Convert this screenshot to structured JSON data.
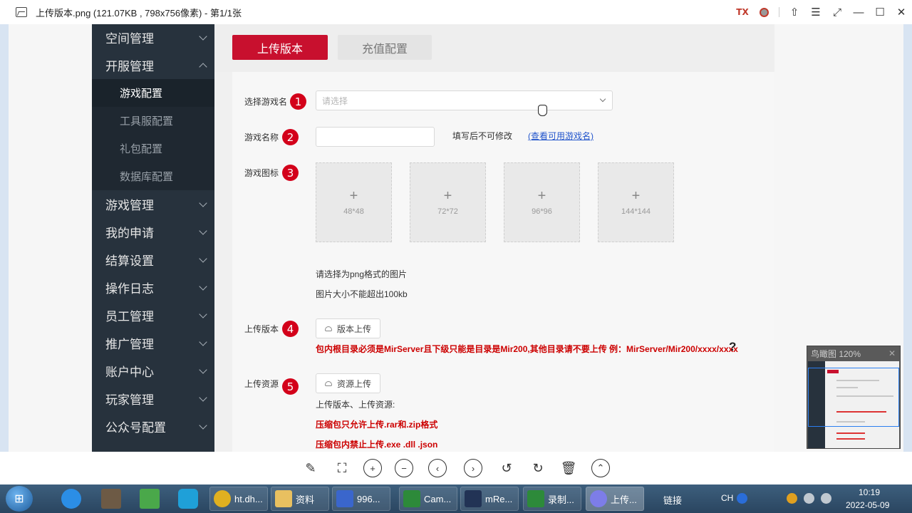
{
  "window": {
    "title": "上传版本.png (121.07KB , 798x756像素) - 第1/1张",
    "tx_label": "TX"
  },
  "sidebar": {
    "items": [
      {
        "label": "空间管理",
        "expanded": false
      },
      {
        "label": "开服管理",
        "expanded": true
      },
      {
        "label": "游戏管理",
        "expanded": false
      },
      {
        "label": "我的申请",
        "expanded": false
      },
      {
        "label": "结算设置",
        "expanded": false
      },
      {
        "label": "操作日志",
        "expanded": false
      },
      {
        "label": "员工管理",
        "expanded": false
      },
      {
        "label": "推广管理",
        "expanded": false
      },
      {
        "label": "账户中心",
        "expanded": false
      },
      {
        "label": "玩家管理",
        "expanded": false
      },
      {
        "label": "公众号配置",
        "expanded": false
      }
    ],
    "subitems": [
      {
        "label": "游戏配置",
        "active": true
      },
      {
        "label": "工具服配置",
        "active": false
      },
      {
        "label": "礼包配置",
        "active": false
      },
      {
        "label": "数据库配置",
        "active": false
      }
    ]
  },
  "tabs": [
    {
      "label": "上传版本",
      "active": true
    },
    {
      "label": "充值配置",
      "active": false
    }
  ],
  "form": {
    "game_select": {
      "label": "选择游戏名",
      "badge": "1",
      "placeholder": "请选择"
    },
    "game_name": {
      "label": "游戏名称",
      "badge": "2",
      "value": "",
      "hint": "填写后不可修改",
      "link": "(查看可用游戏名)"
    },
    "game_icon": {
      "label": "游戏图标",
      "badge": "3",
      "sizes": [
        "48*48",
        "72*72",
        "96*96",
        "144*144"
      ],
      "note1": "请选择为png格式的图片",
      "note2": "图片大小不能超出100kb"
    },
    "upload_version": {
      "label": "上传版本",
      "badge": "4",
      "button": "版本上传",
      "warning": "包内根目录必须是MirServer且下级只能是目录是Mir200,其他目录请不要上传 例：MirServer/Mir200/xxxx/xxxx",
      "help": "?"
    },
    "upload_resource": {
      "label": "上传资源",
      "badge": "5",
      "button": "资源上传",
      "note": "上传版本、上传资源:",
      "rule1": "压缩包只允许上传.rar和.zip格式",
      "rule2": "压缩包内禁止上传.exe .dll .json"
    }
  },
  "navigator": {
    "title": "鸟瞰图 120%"
  },
  "toolbar": {
    "tools": [
      "edit-icon",
      "crop-icon",
      "zoom-in-icon",
      "zoom-out-icon",
      "prev-icon",
      "next-icon",
      "rotate-left-icon",
      "rotate-right-icon",
      "delete-icon",
      "more-icon"
    ]
  },
  "taskbar": {
    "tasks": [
      {
        "label": "ht.dh...",
        "color": "#e0b020"
      },
      {
        "label": "资料",
        "color": "#e8c060"
      },
      {
        "label": "996...",
        "color": "#3a66cc"
      },
      {
        "label": "Cam...",
        "color": "#2d8a3a"
      },
      {
        "label": "mRe...",
        "color": "#223355"
      },
      {
        "label": "录制...",
        "color": "#2d8a3a"
      },
      {
        "label": "上传...",
        "color": "#7d7de8"
      }
    ],
    "link_label": "链接",
    "ime": "CH",
    "time": "10:19",
    "date": "2022-05-09"
  },
  "colors": {
    "accent": "#c8102e",
    "sidebar": "#27323d",
    "badge": "#d3001a",
    "warning": "#cc0000",
    "link": "#2255cc"
  }
}
